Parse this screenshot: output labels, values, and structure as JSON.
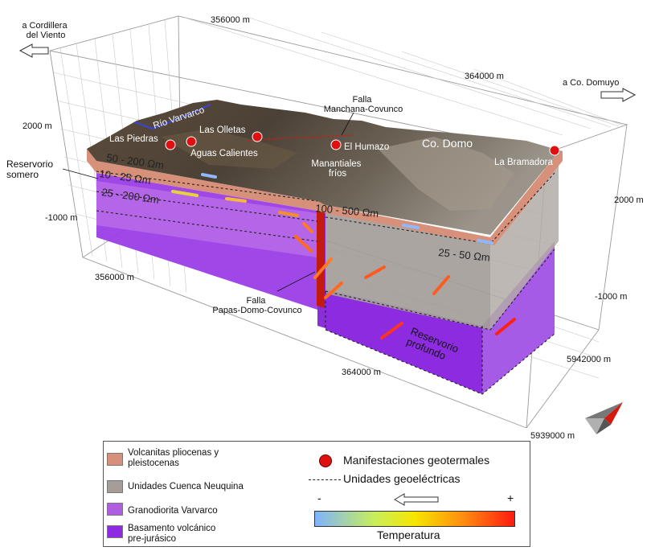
{
  "axes": {
    "top_x": "356000 m",
    "mid_x": "364000 m",
    "bottom_x_left": "356000 m",
    "bottom_x_right": "364000 m",
    "z_left_top": "2000 m",
    "z_left_bottom": "-1000 m",
    "z_right_top": "2000 m",
    "z_right_bottom": "-1000 m",
    "y_mid": "5942000 m",
    "y_bottom": "5939000 m"
  },
  "directions": {
    "west": "a Cordillera\ndel Viento",
    "east": "a Co. Domuyo"
  },
  "places": {
    "rio": "Río Varvarco",
    "las_piedras": "Las Piedras",
    "aguas_calientes": "Aguas Calientes",
    "las_olletas": "Las Olletas",
    "el_humazo": "El Humazo",
    "manantiales": "Manantiales\nfríos",
    "co_domo": "Co. Domo",
    "la_bramadora": "La Bramadora"
  },
  "faults": {
    "manchana": "Falla\nManchana-Covunco",
    "papas": "Falla\nPapas-Domo-Covunco"
  },
  "reservoirs": {
    "somero": "Reservorio\nsomero",
    "profundo": "Reservorio\nprofundo"
  },
  "resistivity": {
    "r1": "50 - 200 Ωm",
    "r2": "10 - 25 Ωm",
    "r3": "25 - 200 Ωm",
    "r4": "100 - 500 Ωm",
    "r5": "25 - 50 Ωm"
  },
  "colors": {
    "volcanitas": "#d7907a",
    "cuenca": "#a49d9a",
    "granodiorita": "#b05ee0",
    "basamento": "#8e2be2",
    "manifestacion": "#e01010",
    "fault": "#c41a10"
  },
  "legend": {
    "volcanitas": "Volcanitas pliocenas y\npleistocenas",
    "cuenca": "Unidades Cuenca Neuquina",
    "granodiorita": "Granodiorita Varvarco",
    "basamento": "Basamento volcánico\npre-jurásico",
    "manifestaciones": "Manifestaciones geotermales",
    "unidades": "Unidades geoeléctricas",
    "minus": "-",
    "plus": "+",
    "temperatura": "Temperatura"
  }
}
